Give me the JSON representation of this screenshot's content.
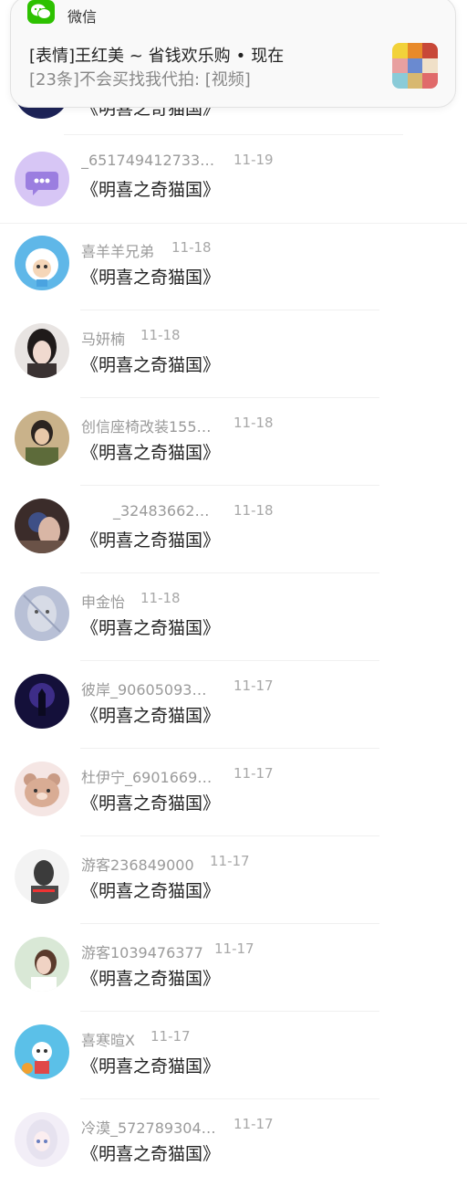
{
  "notification": {
    "app_name": "微信",
    "title": "[表情]王红美 ~ 省钱欢乐购",
    "time": "现在",
    "body": "[23条]不会买找我代拍: [视频]",
    "accent": "#2dc100"
  },
  "conversations": [
    {
      "name": "",
      "time": "",
      "message": "《明喜之奇猫国》"
    },
    {
      "name": "_651749412733…",
      "time": "11-19",
      "message": "《明喜之奇猫国》"
    },
    {
      "name": "喜羊羊兄弟",
      "time": "11-18",
      "message": "《明喜之奇猫国》"
    },
    {
      "name": "马妍楠",
      "time": "11-18",
      "message": "《明喜之奇猫国》"
    },
    {
      "name": "创信座椅改装155…",
      "time": "11-18",
      "message": "《明喜之奇猫国》"
    },
    {
      "name": "_32483662…",
      "time": "11-18",
      "message": "《明喜之奇猫国》"
    },
    {
      "name": "申金怡",
      "time": "11-18",
      "message": "《明喜之奇猫国》"
    },
    {
      "name": "彼岸_90605093…",
      "time": "11-17",
      "message": "《明喜之奇猫国》"
    },
    {
      "name": "杜伊宁_6901669…",
      "time": "11-17",
      "message": "《明喜之奇猫国》"
    },
    {
      "name": "游客236849000",
      "time": "11-17",
      "message": "《明喜之奇猫国》"
    },
    {
      "name": "游客1039476377",
      "time": "11-17",
      "message": "《明喜之奇猫国》"
    },
    {
      "name": "喜寒暄X",
      "time": "11-17",
      "message": "《明喜之奇猫国》"
    },
    {
      "name": "冷漠_572789304…",
      "time": "11-17",
      "message": "《明喜之奇猫国》"
    }
  ]
}
